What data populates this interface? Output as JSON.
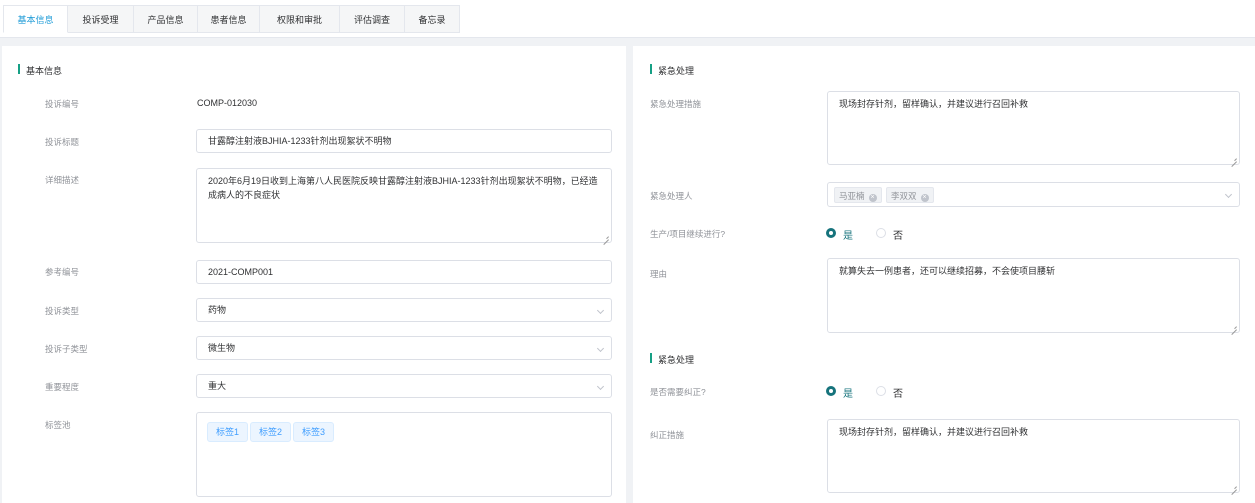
{
  "tabs": [
    "基本信息",
    "投诉受理",
    "产品信息",
    "患者信息",
    "权限和审批",
    "评估调查",
    "备忘录"
  ],
  "left": {
    "section_title": "基本信息",
    "complaint_no_label": "投诉编号",
    "complaint_no_value": "COMP-012030",
    "title_label": "投诉标题",
    "title_value": "甘露醇注射液BJHIA-1233针剂出现絮状不明物",
    "desc_label": "详细描述",
    "desc_value": "2020年6月19日收到上海第八人民医院反映甘露醇注射液BJHIA-1233针剂出现絮状不明物，已经造成病人的不良症状",
    "ref_label": "参考编号",
    "ref_value": "2021-COMP001",
    "type_label": "投诉类型",
    "type_value": "药物",
    "subtype_label": "投诉子类型",
    "subtype_value": "微生物",
    "severity_label": "重要程度",
    "severity_value": "重大",
    "tags_label": "标签池",
    "tags": [
      "标签1",
      "标签2",
      "标签3"
    ]
  },
  "right": {
    "section1_title": "紧急处理",
    "measure_label": "紧急处理措施",
    "measure_value": "现场封存针剂，留样确认，并建议进行召回补救",
    "handler_label": "紧急处理人",
    "handlers": [
      "马亚楠",
      "李双双"
    ],
    "continue_label": "生产/项目继续进行?",
    "yes_label": "是",
    "no_label": "否",
    "reason_label": "理由",
    "reason_value": "就算失去一例患者，还可以继续招募，不会使项目腰斩",
    "section2_title": "紧急处理",
    "correct_label": "是否需要纠正?",
    "yes2_label": "是",
    "no2_label": "否",
    "correct_measure_label": "纠正措施",
    "correct_measure_value": "现场封存针剂，留样确认，并建议进行召回补救"
  },
  "icons": {
    "chevron": "chevron-down-icon",
    "chip_close": "close-circle-icon",
    "resize": "resize-handle-icon"
  },
  "colors": {
    "active_tab": "#1e9bd7",
    "section_bar": "#16a085",
    "radio_checked": "#16737c",
    "tag_text": "#409eff"
  }
}
